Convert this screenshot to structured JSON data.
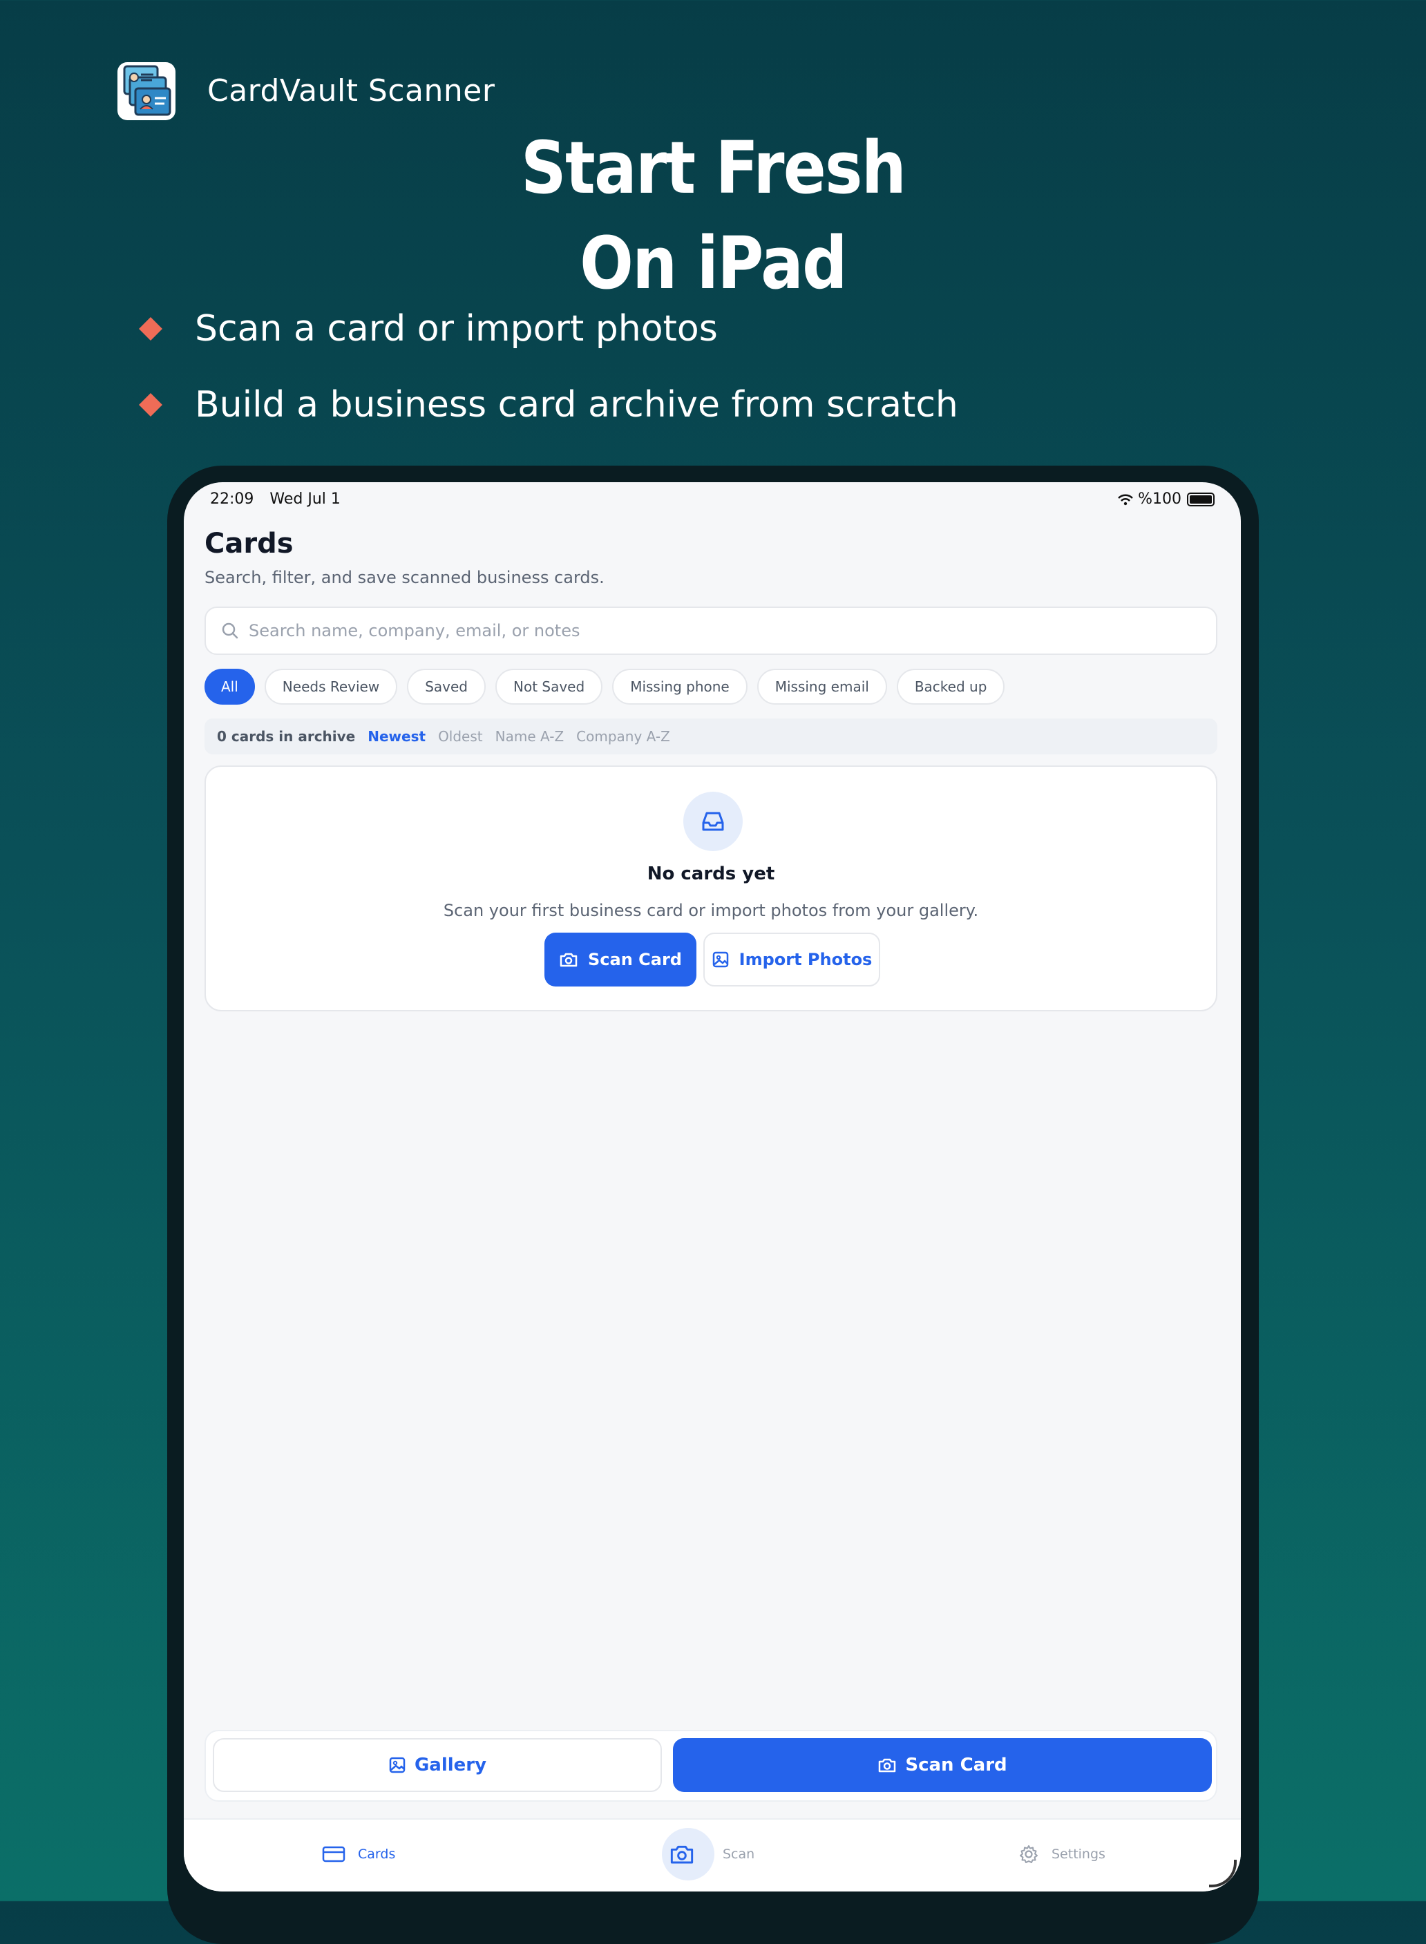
{
  "marketing": {
    "app_name": "CardVault Scanner",
    "headline_line1": "Start Fresh",
    "headline_line2": "On iPad",
    "bullets": [
      "Scan a card or import photos",
      "Build a business card archive from scratch"
    ],
    "accent_color": "#ef6c57"
  },
  "status_bar": {
    "time": "22:09",
    "date": "Wed Jul 1",
    "battery": "%100"
  },
  "cards_screen": {
    "title": "Cards",
    "subtitle": "Search, filter, and save scanned business cards.",
    "search_placeholder": "Search name, company, email, or notes",
    "filters": [
      "All",
      "Needs Review",
      "Saved",
      "Not Saved",
      "Missing phone",
      "Missing email",
      "Backed up"
    ],
    "active_filter": "All",
    "archive_count": "0 cards in archive",
    "sort_options": [
      "Newest",
      "Oldest",
      "Name A-Z",
      "Company A-Z"
    ],
    "active_sort": "Newest",
    "empty_state": {
      "icon": "inbox-icon",
      "title": "No cards yet",
      "text": "Scan your first business card or import photos from your gallery.",
      "primary_button": "Scan Card",
      "secondary_button": "Import Photos"
    },
    "bottom_actions": {
      "gallery_label": "Gallery",
      "scan_label": "Scan Card"
    }
  },
  "tab_bar": {
    "tabs": [
      {
        "label": "Cards",
        "icon": "card-icon",
        "active": true
      },
      {
        "label": "Scan",
        "icon": "camera-icon",
        "active": false
      },
      {
        "label": "Settings",
        "icon": "gear-icon",
        "active": false
      }
    ]
  },
  "colors": {
    "primary": "#2563eb",
    "background_top": "#073d47",
    "background_bottom": "#0b6f68"
  }
}
